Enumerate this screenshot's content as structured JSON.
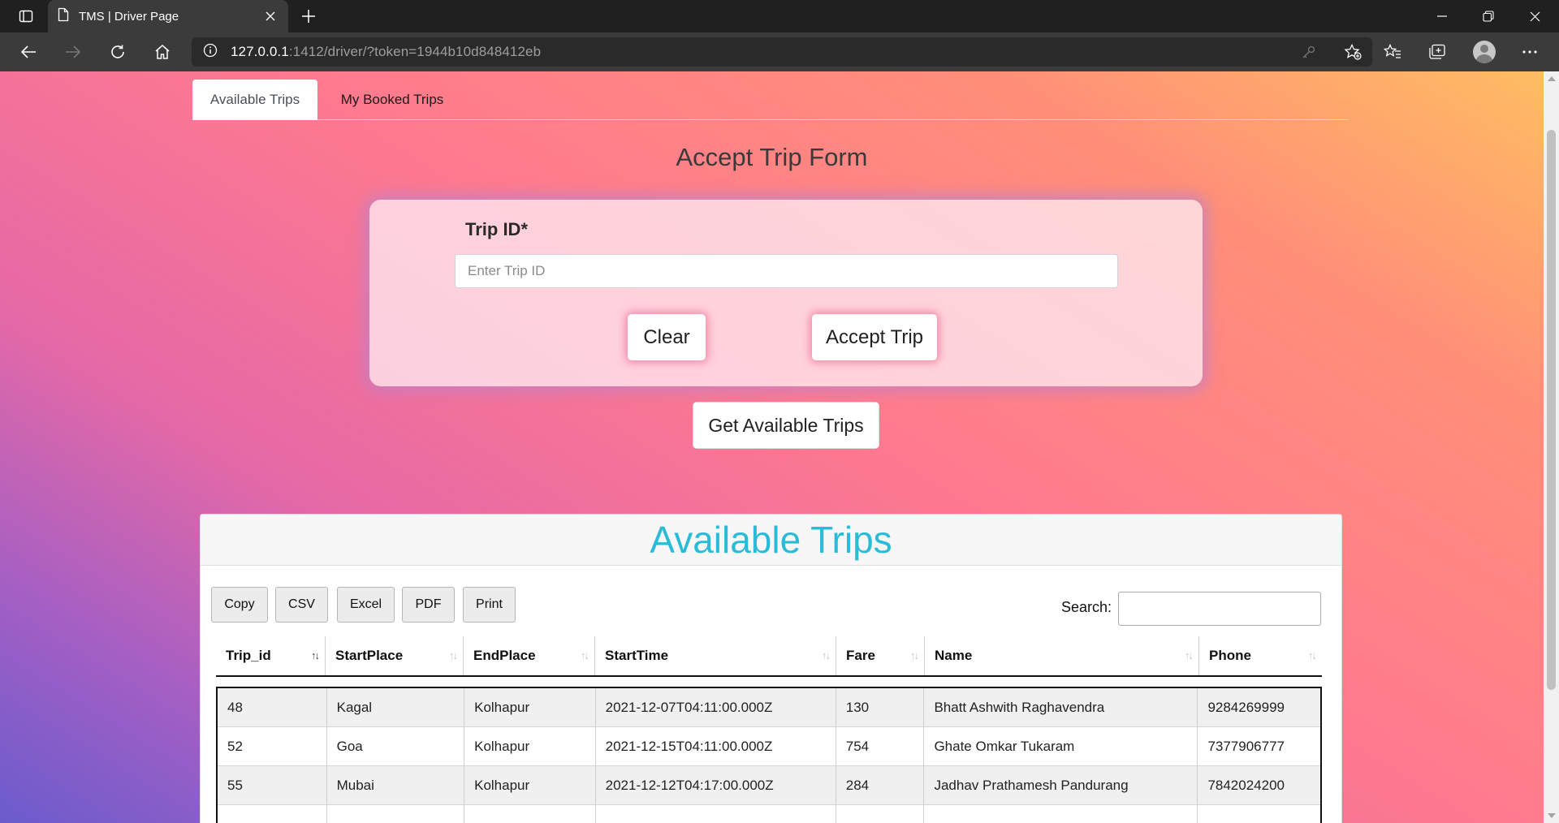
{
  "browser": {
    "tab_title": "TMS | Driver Page",
    "url_host": "127.0.0.1",
    "url_rest": ":1412/driver/?token=1944b10d848412eb"
  },
  "nav_tabs": {
    "available": "Available Trips",
    "booked": "My Booked Trips"
  },
  "form": {
    "heading": "Accept Trip Form",
    "trip_id_label": "Trip ID*",
    "trip_id_placeholder": "Enter Trip ID",
    "trip_id_value": "",
    "clear_label": "Clear",
    "accept_label": "Accept Trip",
    "get_trips_label": "Get Available Trips"
  },
  "table": {
    "title": "Available Trips",
    "buttons": [
      "Copy",
      "CSV",
      "Excel",
      "PDF",
      "Print"
    ],
    "search_label": "Search:",
    "search_value": "",
    "columns": [
      "Trip_id",
      "StartPlace",
      "EndPlace",
      "StartTime",
      "Fare",
      "Name",
      "Phone"
    ],
    "sorted_column": "Trip_id",
    "rows": [
      [
        "48",
        "Kagal",
        "Kolhapur",
        "2021-12-07T04:11:00.000Z",
        "130",
        "Bhatt Ashwith Raghavendra",
        "9284269999"
      ],
      [
        "52",
        "Goa",
        "Kolhapur",
        "2021-12-15T04:11:00.000Z",
        "754",
        "Ghate Omkar Tukaram",
        "7377906777"
      ],
      [
        "55",
        "Mubai",
        "Kolhapur",
        "2021-12-12T04:17:00.000Z",
        "284",
        "Jadhav Prathamesh Pandurang",
        "7842024200"
      ]
    ]
  },
  "colors": {
    "title_accent": "#2bbbd8",
    "gradient": [
      "#6a5ccc",
      "#e569a6",
      "#ff7a8e",
      "#ffbd62"
    ]
  },
  "icons": [
    "tab-actions-icon",
    "page-icon",
    "close-icon",
    "plus-icon",
    "minimize-icon",
    "restore-icon",
    "window-close-icon",
    "back-icon",
    "forward-icon",
    "refresh-icon",
    "home-icon",
    "info-icon",
    "key-icon",
    "add-favorite-icon",
    "favorites-icon",
    "collections-icon",
    "profile-icon",
    "more-icon"
  ]
}
